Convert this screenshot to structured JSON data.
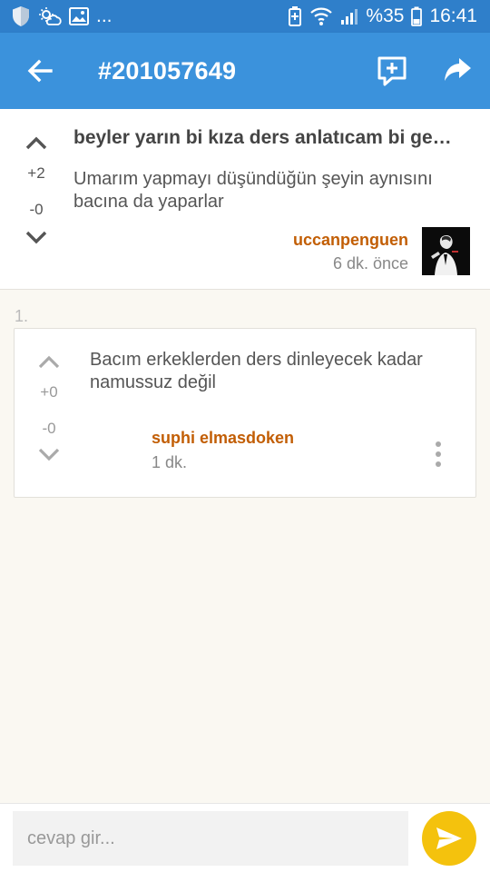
{
  "status_bar": {
    "notifications_more": "...",
    "battery": "%35",
    "time": "16:41"
  },
  "app_bar": {
    "title": "#201057649"
  },
  "post": {
    "title": "beyler yarın bi kıza ders anlatıcam bi ge…",
    "body": "Umarım yapmayı düşündüğün şeyin aynısını bacına da yaparlar",
    "upvotes": "+2",
    "downvotes": "-0",
    "author": "uccanpenguen",
    "time": "6 dk. önce"
  },
  "replies": [
    {
      "index": "1.",
      "body": "Bacım erkeklerden ders dinleyecek kadar namussuz değil",
      "upvotes": "+0",
      "downvotes": "-0",
      "author": "suphi elmasdoken",
      "time": "1 dk."
    }
  ],
  "reply_bar": {
    "placeholder": "cevap gir..."
  },
  "colors": {
    "status_bar": "#2f7fca",
    "app_bar": "#3b92dc",
    "author": "#c25e05",
    "send_button": "#f4c20d",
    "background": "#faf8f2"
  },
  "icons": {
    "back": "arrow-left-icon",
    "comment": "add-comment-icon",
    "share": "share-icon",
    "upvote": "chevron-up-icon",
    "downvote": "chevron-down-icon",
    "more": "more-vert-icon",
    "send": "send-icon"
  }
}
